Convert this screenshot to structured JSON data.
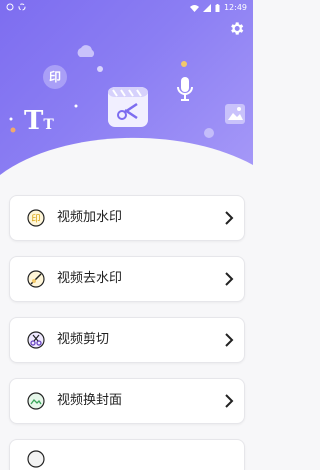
{
  "status_bar": {
    "time": "12:49"
  },
  "header": {
    "settings_icon": "gear-icon",
    "decorations": [
      "video-clip-icon",
      "watermark-text-icon",
      "text-tt-icon",
      "microphone-icon",
      "image-icon",
      "cloud-icon"
    ],
    "decoration_letters": {
      "watermark": "印",
      "text": "T"
    }
  },
  "menu": {
    "items": [
      {
        "label": "视频加水印",
        "icon": "watermark-add-icon"
      },
      {
        "label": "视频去水印",
        "icon": "watermark-remove-icon"
      },
      {
        "label": "视频剪切",
        "icon": "scissors-icon"
      },
      {
        "label": "视频换封面",
        "icon": "cover-image-icon"
      }
    ]
  },
  "colors": {
    "header_start": "#7d6df0",
    "header_end": "#a79af8",
    "icon_accent": "#f5c542"
  }
}
